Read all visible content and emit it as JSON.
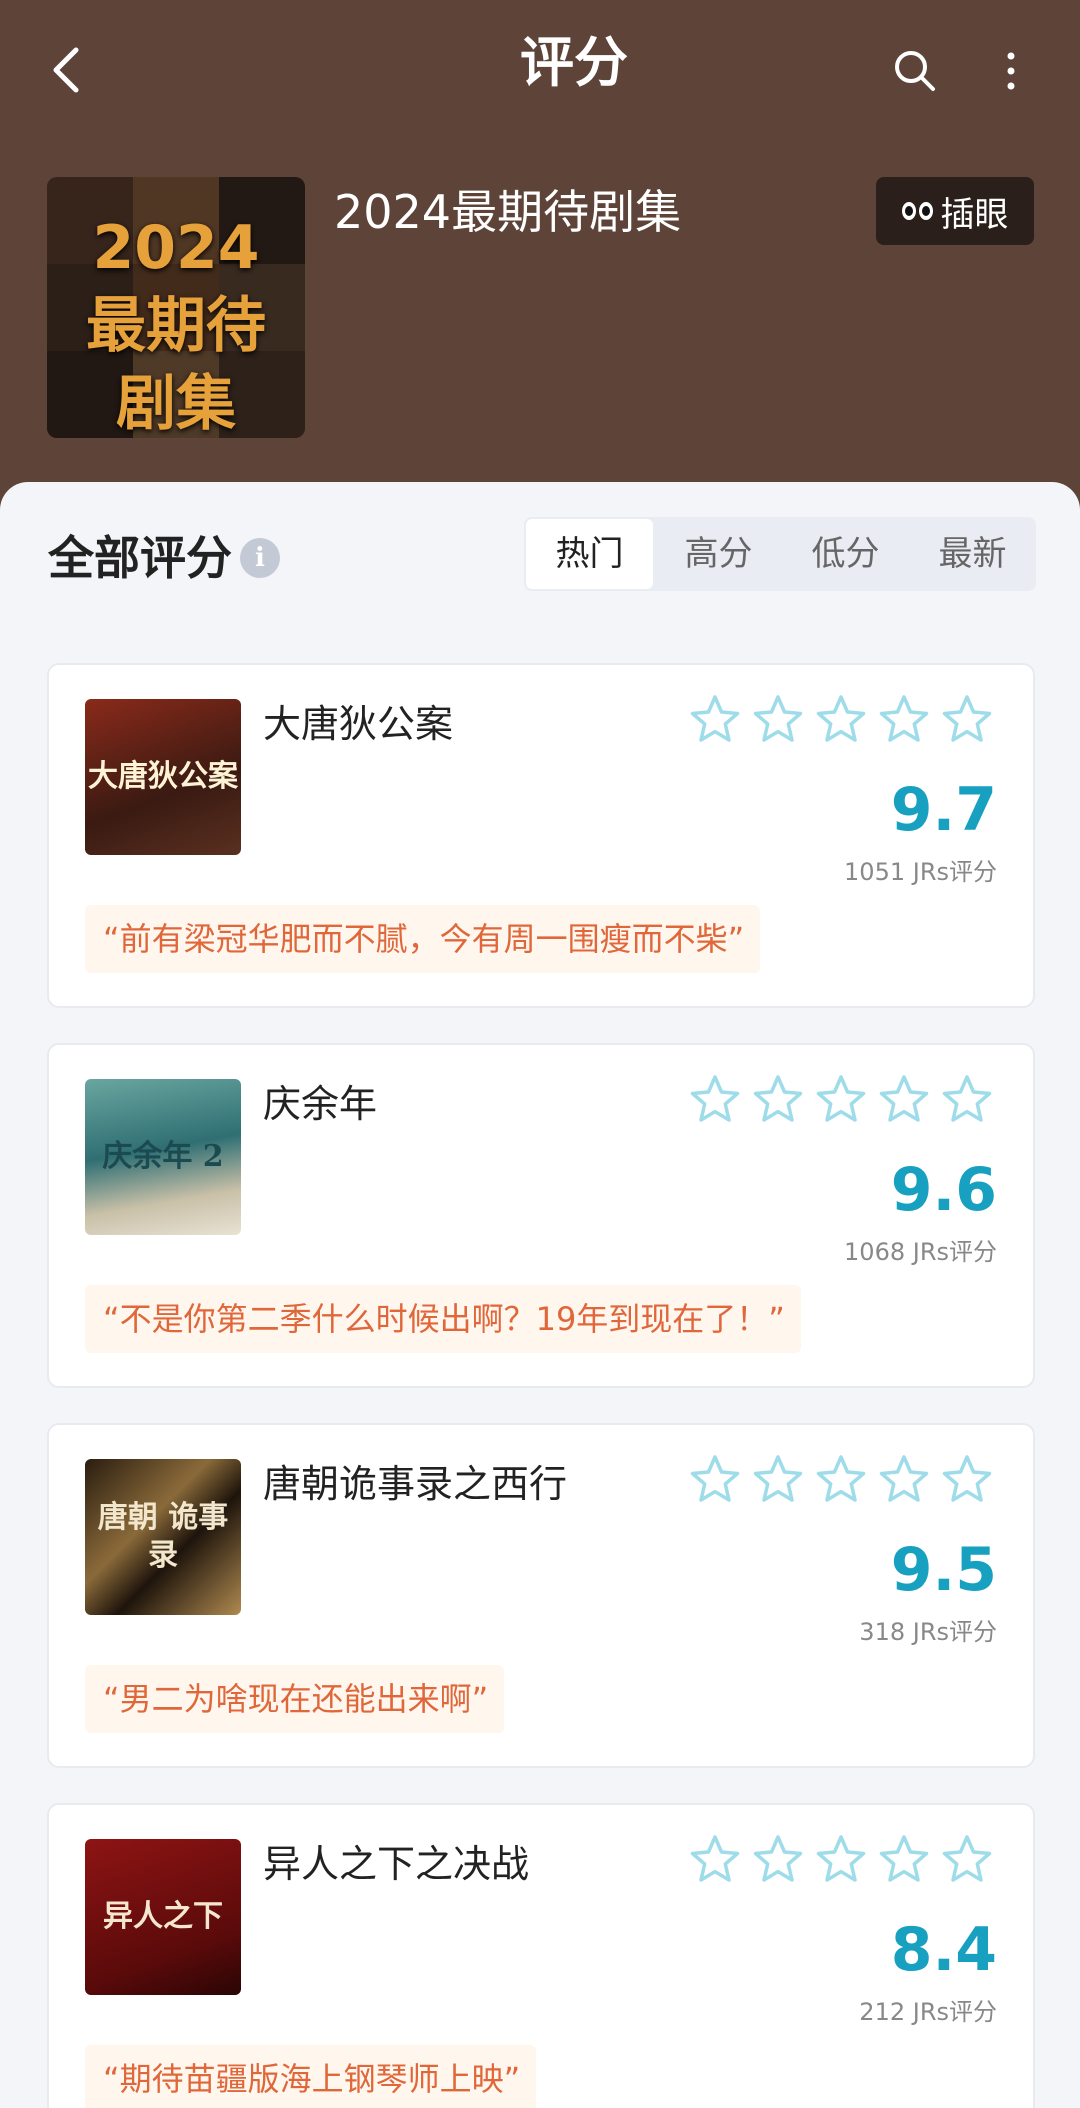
{
  "header": {
    "title": "评分",
    "collection_title": "2024最期待剧集",
    "poster_text": [
      "2024",
      "最期待",
      "剧集"
    ],
    "peek_button_label": "插眼"
  },
  "section": {
    "title": "全部评分",
    "info_glyph": "i",
    "tabs": [
      {
        "label": "热门",
        "active": true
      },
      {
        "label": "高分",
        "active": false
      },
      {
        "label": "低分",
        "active": false
      },
      {
        "label": "最新",
        "active": false
      }
    ]
  },
  "items": [
    {
      "title": "大唐狄公案",
      "score": "9.7",
      "rating_count": "1051 JRs评分",
      "quote": "“前有梁冠华肥而不腻，今有周一围瘦而不柴”",
      "thumb_text": "大唐狄公案"
    },
    {
      "title": "庆余年",
      "score": "9.6",
      "rating_count": "1068 JRs评分",
      "quote": "“不是你第二季什么时候出啊？19年到现在了！”",
      "thumb_text": "庆余年 2"
    },
    {
      "title": "唐朝诡事录之西行",
      "score": "9.5",
      "rating_count": "318 JRs评分",
      "quote": "“男二为啥现在还能出来啊”",
      "thumb_text": "唐朝 诡事录"
    },
    {
      "title": "异人之下之决战",
      "score": "8.4",
      "rating_count": "212 JRs评分",
      "quote": "“期待苗疆版海上钢琴师上映”",
      "thumb_text": "异人之下"
    }
  ],
  "icons": {
    "back": "chevron-left-icon",
    "search": "search-icon",
    "more": "more-vertical-icon",
    "info": "info-icon",
    "star": "star-outline-icon",
    "eyes": "eyes-icon"
  },
  "colors": {
    "header_bg": "#5e4438",
    "score": "#17a0bf",
    "star_outline": "#9fdcea",
    "quote_text": "#e0673a",
    "quote_bg": "#fff6ee"
  }
}
